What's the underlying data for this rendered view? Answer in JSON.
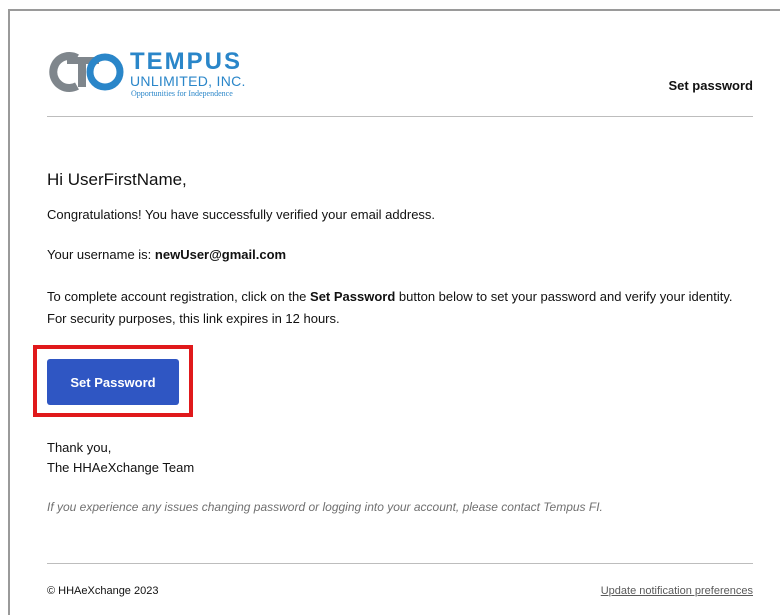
{
  "header": {
    "logo": {
      "name": "TEMPUS",
      "subline": "UNLIMITED, INC.",
      "tagline": "Opportunities for Independence",
      "color": "#2a86c9"
    },
    "title": "Set password"
  },
  "body": {
    "greeting": "Hi UserFirstName,",
    "verified_text": "Congratulations! You have successfully verified your email address.",
    "username_prefix": "Your username is: ",
    "username": "newUser@gmail.com",
    "instruction_pre": "To complete account registration, click on the ",
    "instruction_bold": "Set Password",
    "instruction_post": " button below to set your password and verify your identity. For security purposes, this link expires in 12 hours.",
    "button_label": "Set Password",
    "button_color": "#2f56c3",
    "highlight_color": "#e0191b",
    "thanks_line1": "Thank you,",
    "thanks_line2": "The HHAeXchange Team",
    "note": "If you experience any issues changing password or logging into your account, please contact Tempus FI."
  },
  "footer": {
    "copyright": "© HHAeXchange 2023",
    "preferences_link": "Update notification preferences"
  }
}
